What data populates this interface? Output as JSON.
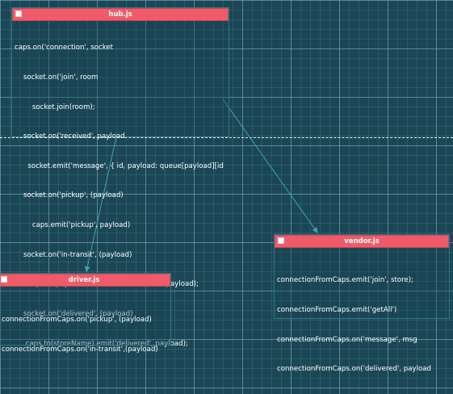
{
  "hub": {
    "title": "hub.js",
    "lines": [
      "caps.on('connection', socket",
      "    socket.on('join', room",
      "        socket.join(room);",
      "    socket.on('received', payload",
      "      socket.emit('message', { id, payload: queue[payload][id",
      "    socket.on('pickup', (payload)",
      "        caps.emit('pickup', payload)",
      "    socket.on('in-transit', (payload)",
      "      caps.to(payload.store).emit('in-transit', payload);",
      "    socket.on('delivered', (payload)",
      "     caps.to(storeName).emit('delivered', payload);"
    ]
  },
  "vendor": {
    "title": "vendor.js",
    "lines": [
      "connectionFromCaps.emit('join', store);",
      "connectionFromCaps.emit('getAll')",
      "connectionFromCaps.on('message', msg",
      "connectionFromCaps.on('delivered', payload"
    ]
  },
  "driver": {
    "title": "driver.js",
    "lines": [
      "connectionFromCaps.on('pickup', (payload)",
      "connectionFromCaps.on('in-transit',(payload)"
    ]
  },
  "colors": {
    "background": "#1b4655",
    "header": "#f05b69",
    "connector": "#3aa6b4",
    "text": "#ffffff"
  }
}
